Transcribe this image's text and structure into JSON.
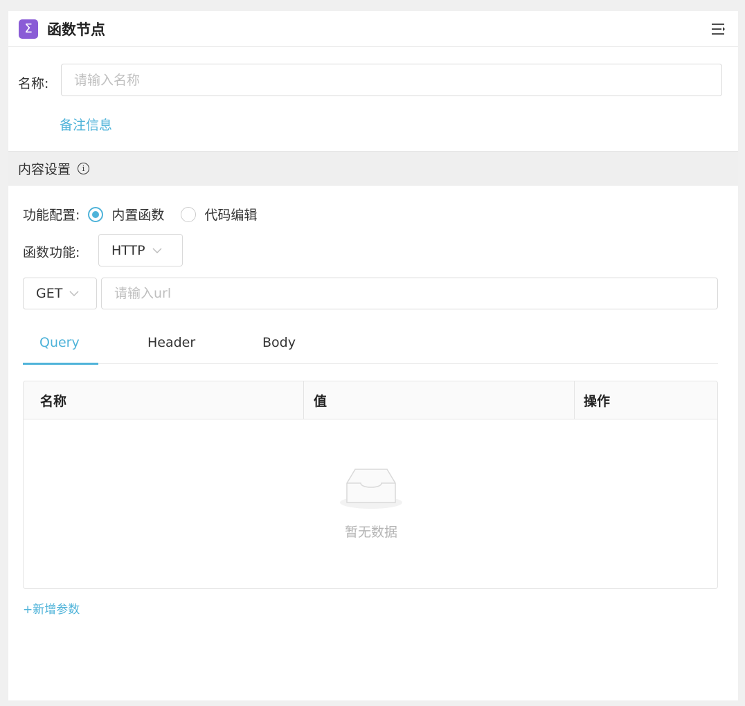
{
  "header": {
    "icon_glyph": "Σ",
    "title": "函数节点",
    "menu_icon": "collapse-menu-icon"
  },
  "basic": {
    "name_label": "名称:",
    "name_placeholder": "请输入名称",
    "remark_link": "备注信息"
  },
  "content_section": {
    "title": "内容设置",
    "info_glyph": "i"
  },
  "config": {
    "label": "功能配置:",
    "options": [
      {
        "label": "内置函数",
        "checked": true
      },
      {
        "label": "代码编辑",
        "checked": false
      }
    ]
  },
  "function": {
    "label": "函数功能:",
    "selected": "HTTP"
  },
  "request": {
    "method": "GET",
    "url_placeholder": "请输入url"
  },
  "tabs": [
    {
      "label": "Query",
      "active": true
    },
    {
      "label": "Header",
      "active": false
    },
    {
      "label": "Body",
      "active": false
    }
  ],
  "table": {
    "columns": [
      "名称",
      "值",
      "操作"
    ],
    "rows": [],
    "empty_text": "暂无数据"
  },
  "add_param": "+新增参数",
  "colors": {
    "accent": "#4fb3d9",
    "icon_bg": "#8a5cd6"
  }
}
